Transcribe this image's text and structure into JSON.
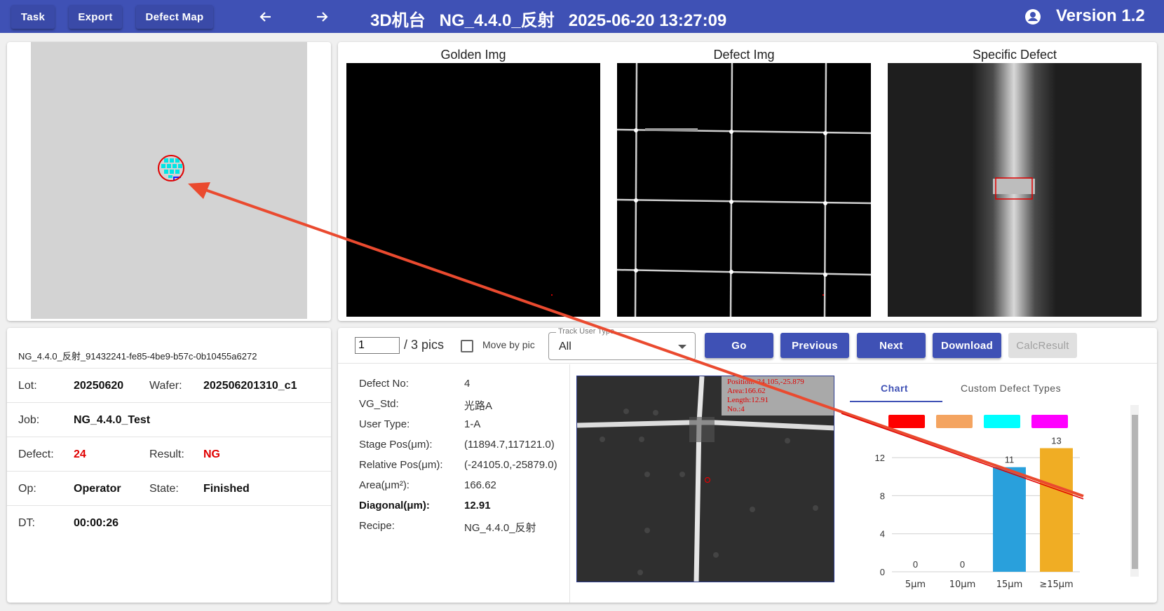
{
  "topbar": {
    "buttons": [
      "Task",
      "Export",
      "Defect Map"
    ],
    "title": "3D机台   NG_4.4.0_反射   2025-06-20 13:27:09",
    "version": "Version 1.2"
  },
  "images": {
    "golden_title": "Golden Img",
    "defect_title": "Defect Img",
    "specific_title": "Specific Defect"
  },
  "info": {
    "id": "NG_4.4.0_反射_91432241-fe85-4be9-b57c-0b10455a6272",
    "lot_label": "Lot:",
    "lot": "20250620",
    "wafer_label": "Wafer:",
    "wafer": "202506201310_c1",
    "job_label": "Job:",
    "job": "NG_4.4.0_Test",
    "defect_label": "Defect:",
    "defect": "24",
    "result_label": "Result:",
    "result": "NG",
    "op_label": "Op:",
    "op": "Operator",
    "state_label": "State:",
    "state": "Finished",
    "dt_label": "DT:",
    "dt": "00:00:26"
  },
  "controls": {
    "page_value": "1",
    "pics_total": "/ 3 pics",
    "move_by_pic": "Move by pic",
    "track_label": "Track User Type",
    "track_value": "All",
    "go": "Go",
    "previous": "Previous",
    "next": "Next",
    "download": "Download",
    "calc": "CalcResult"
  },
  "detail": {
    "rows": [
      {
        "label": "Defect No:",
        "value": "4"
      },
      {
        "label": "VG_Std:",
        "value": "光路A"
      },
      {
        "label": "User Type:",
        "value": "1-A"
      },
      {
        "label": "Stage Pos(μm):",
        "value": "(11894.7,117121.0)"
      },
      {
        "label": "Relative Pos(μm):",
        "value": "(-24105.0,-25879.0)"
      },
      {
        "label": "Area(μm²):",
        "value": "166.62"
      },
      {
        "label": "Diagonal(μm):",
        "value": "12.91"
      },
      {
        "label": "Recipe:",
        "value": "NG_4.4.0_反射"
      }
    ],
    "overlay": [
      "Position:-24.105,-25.879",
      "Area:166.62",
      "Length:12.91",
      "No.:4"
    ]
  },
  "tabs": {
    "chart": "Chart",
    "custom": "Custom Defect Types"
  },
  "colors": {
    "primary": "#3f51b5",
    "red": "#ff0000",
    "orange": "#f4a460",
    "cyan": "#00ffff",
    "magenta": "#ff00ff",
    "bar_blue": "#29a0dc",
    "bar_orange": "#f0ad24",
    "annotation_arrow": "#ea4a2f"
  },
  "chart_data": {
    "type": "bar",
    "categories": [
      "5μm",
      "10μm",
      "15μm",
      "≥15μm"
    ],
    "values": [
      0,
      0,
      11,
      13
    ],
    "ylim": [
      0,
      14
    ],
    "yticks": [
      "0",
      "4",
      "8",
      "12"
    ],
    "grid": true
  }
}
